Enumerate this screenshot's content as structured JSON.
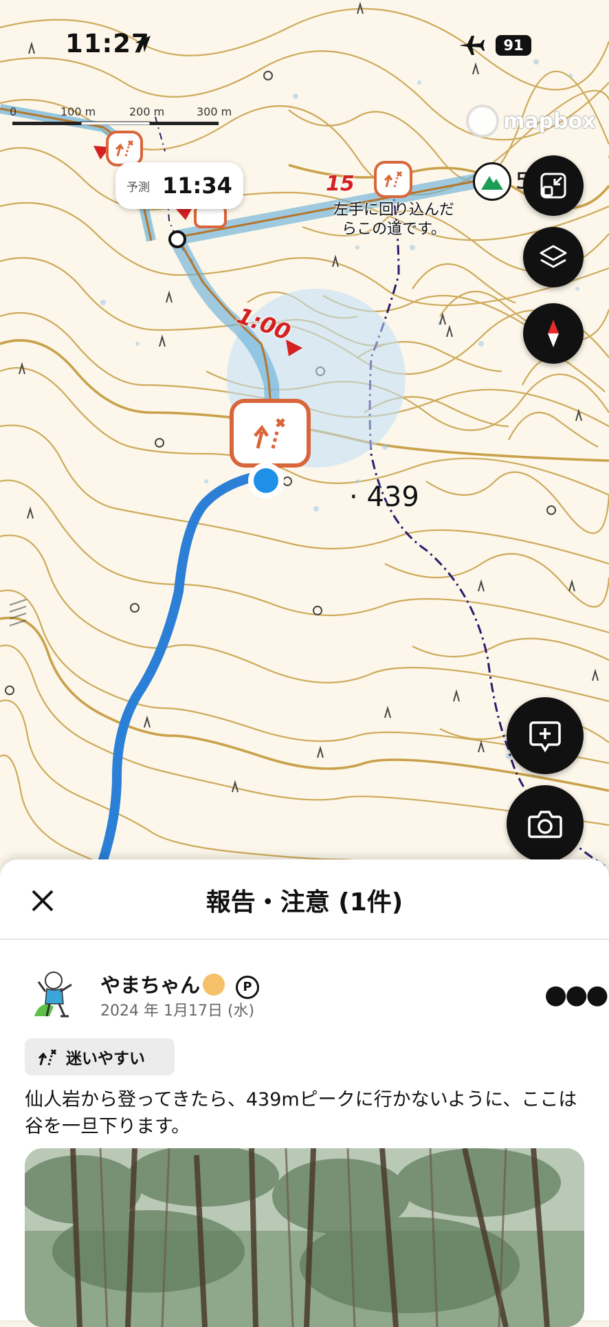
{
  "status_bar": {
    "time": "11:27",
    "battery": "91"
  },
  "map": {
    "scale": [
      "0",
      "100 m",
      "200 m",
      "300 m"
    ],
    "attribution": "mapbox",
    "predict_label": "予測",
    "predict_time": "11:34",
    "segment_time": "1:00",
    "segment_count": "15",
    "note_line1": "左手に回り込んだ",
    "note_line2": "らこの道です。",
    "elevation": "439",
    "peak_number": "5"
  },
  "panel": {
    "title": "報告・注意 (1件)",
    "report": {
      "user": "やまちゃん",
      "premium_badge": "P",
      "date": "2024 年 1月17日 (水)",
      "tag": "迷いやすい",
      "text": "仙人岩から登ってきたら、439mピークに行かないように、ここは谷を一旦下ります。"
    }
  },
  "colors": {
    "contour": "#c9a14b",
    "route": "#2b7fd6",
    "marker": "#d9653a",
    "trail": "#2a1a6e"
  }
}
